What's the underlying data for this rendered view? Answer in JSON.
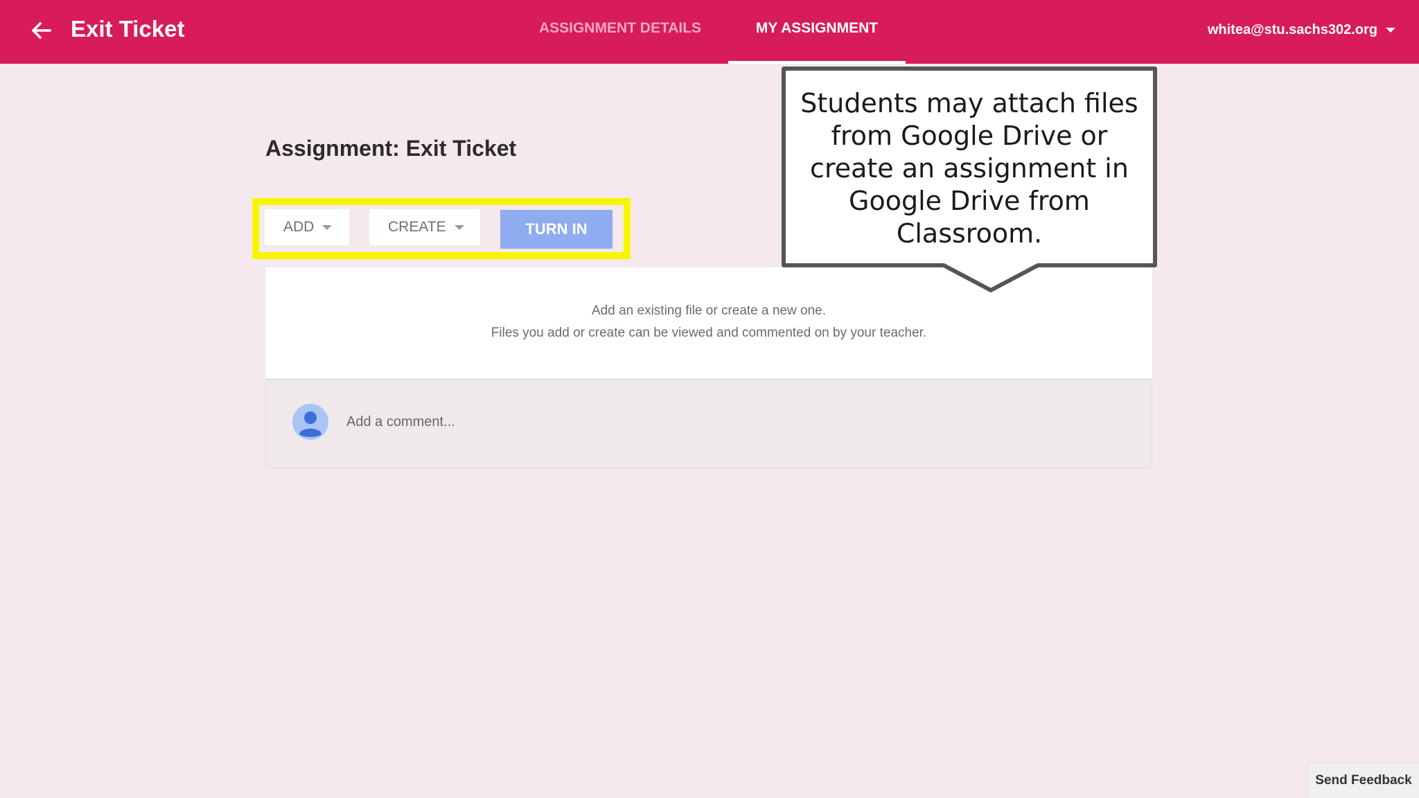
{
  "header": {
    "title": "Exit Ticket",
    "tabs": [
      {
        "label": "ASSIGNMENT DETAILS",
        "active": false
      },
      {
        "label": "MY ASSIGNMENT",
        "active": true
      }
    ],
    "account": "whitea@stu.sachs302.org",
    "color": "#d81b5a"
  },
  "main": {
    "heading": "Assignment: Exit Ticket",
    "buttons": {
      "add": "ADD",
      "create": "CREATE",
      "turn_in": "TURN IN"
    },
    "files_card": {
      "line1": "Add an existing file or create a new one.",
      "line2": "Files you add or create can be viewed and commented on by your teacher."
    },
    "comment": {
      "placeholder": "Add a comment..."
    }
  },
  "callout": {
    "text": "Students may attach files from Google Drive or create an assignment in Google Drive from Classroom."
  },
  "footer": {
    "feedback": "Send Feedback"
  },
  "icons": {
    "back": "arrow-back-icon",
    "account_menu": "chevron-down-icon",
    "avatar": "user-avatar-icon"
  }
}
